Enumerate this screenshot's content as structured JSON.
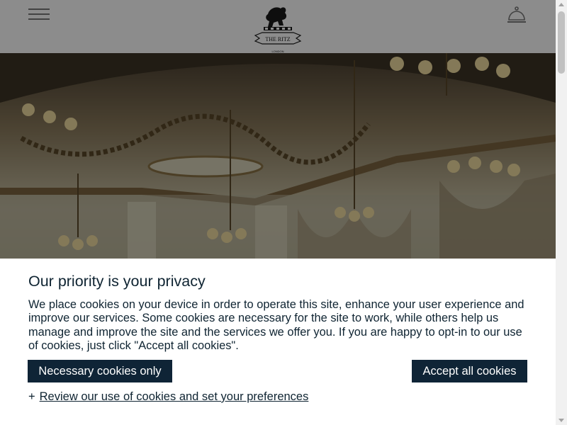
{
  "header": {
    "menu_icon": "hamburger-menu-icon",
    "logo": {
      "brand": "THE RITZ",
      "city": "LONDON"
    },
    "concierge_icon": "concierge-bell-icon"
  },
  "hero": {
    "description_icon": "ballroom-chandelier-image"
  },
  "cookie_banner": {
    "title": "Our priority is your privacy",
    "body": "We place cookies on your device in order to operate this site, enhance your user experience and improve our services. Some cookies are necessary for the site to work, while others help us manage and improve the site and the services we offer you. If you are happy to opt-in to our use of cookies, just click \"Accept all cookies\".",
    "necessary_button": "Necessary cookies only",
    "accept_button": "Accept all cookies",
    "review_prefix": "+",
    "review_link": "Review our use of cookies and set your preferences"
  },
  "colors": {
    "primary_dark": "#0f2436",
    "text": "#0f2432",
    "background": "#ffffff"
  }
}
